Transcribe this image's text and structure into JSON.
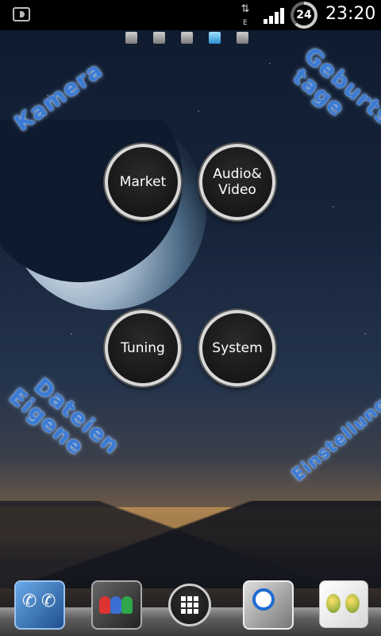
{
  "status_bar": {
    "network_type": "E",
    "battery_level": "24",
    "time": "23:20"
  },
  "page_indicator": {
    "count": 5,
    "active_index": 3
  },
  "wallpaper_labels": {
    "kamera": "Kamera",
    "geburtstage_line1": "Geburts",
    "geburtstage_line2": "tage",
    "eigene_dateien_line1": "Dateien",
    "eigene_dateien_line2": "Eigene",
    "einstellungen": "Einstellungen"
  },
  "shortcuts": {
    "market": "Market",
    "audio_video_line1": "Audio&",
    "audio_video_line2": "Video",
    "tuning": "Tuning",
    "system": "System"
  },
  "dock": {
    "items": [
      "phone-app-icon",
      "contacts-app-icon",
      "app-drawer-icon",
      "search-app-icon",
      "cube-app-icon"
    ]
  },
  "colors": {
    "label_blue": "#3b7bd4",
    "status_bar_bg": "#000000",
    "accent_page_dot": "#2a8fd0"
  }
}
